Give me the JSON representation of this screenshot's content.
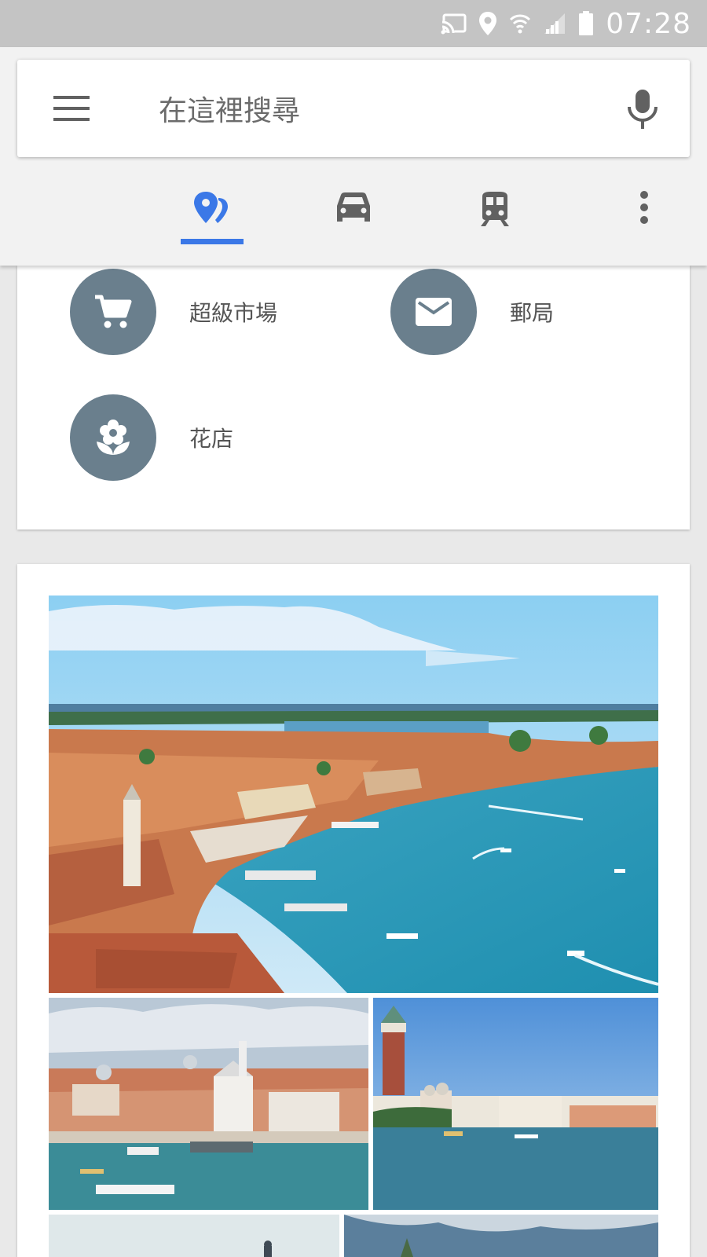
{
  "status_bar": {
    "time": "07:28",
    "icons": [
      "cast-icon",
      "location-icon",
      "wifi-icon",
      "signal-icon",
      "battery-icon"
    ]
  },
  "search": {
    "placeholder": "在這裡搜尋"
  },
  "tabs": [
    {
      "icon": "explore-pin-icon",
      "active": true
    },
    {
      "icon": "car-icon",
      "active": false
    },
    {
      "icon": "train-icon",
      "active": false
    },
    {
      "icon": "more-vert-icon",
      "active": false
    }
  ],
  "categories": [
    {
      "label": "超級市場",
      "icon": "cart-icon"
    },
    {
      "label": "郵局",
      "icon": "mail-icon"
    },
    {
      "label": "花店",
      "icon": "flower-icon"
    }
  ],
  "photos": [
    {
      "name": "venice-panorama"
    },
    {
      "name": "venice-church-waterfront"
    },
    {
      "name": "venice-campanile"
    },
    {
      "name": "venice-photo-4"
    },
    {
      "name": "venice-photo-5"
    }
  ],
  "colors": {
    "accent": "#3b78e7",
    "category_circle": "#6a7f8d",
    "status_bar": "#c4c4c4"
  }
}
